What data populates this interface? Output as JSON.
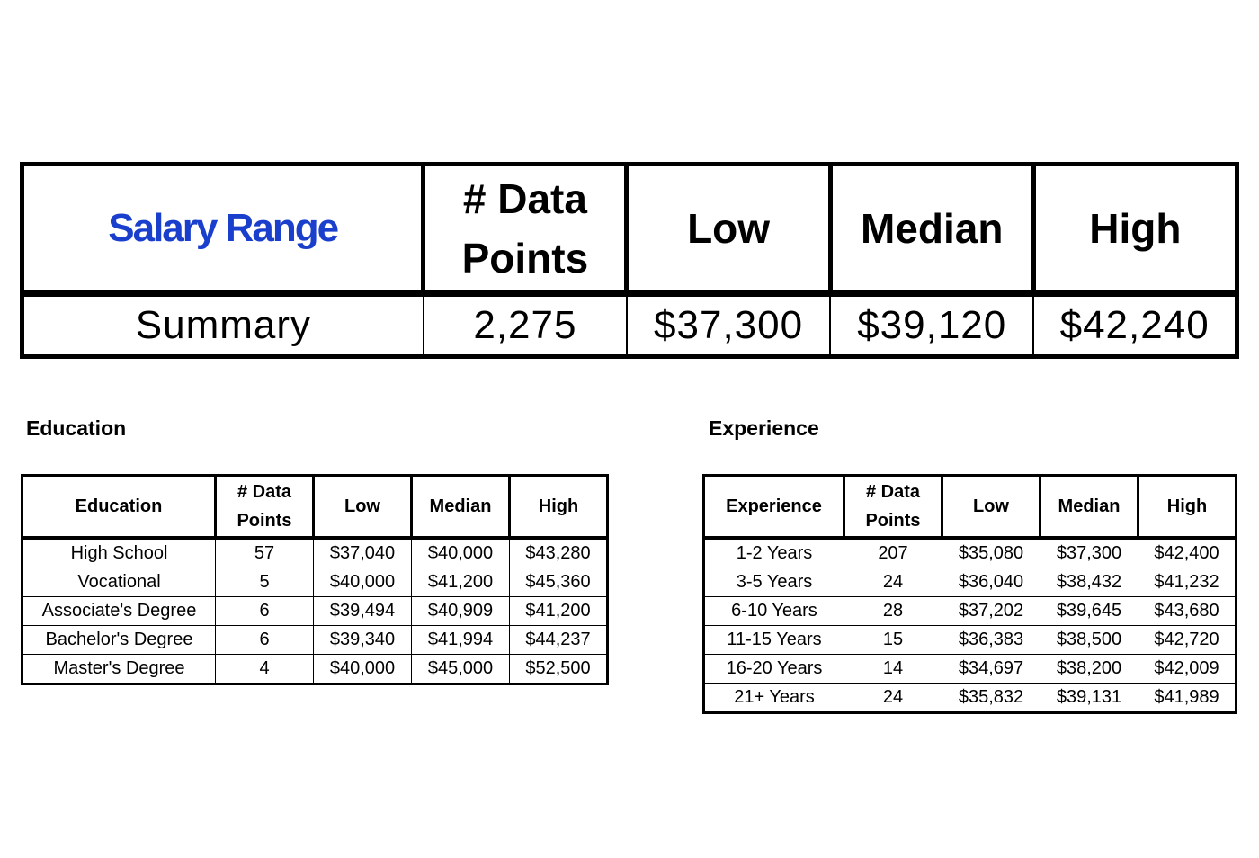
{
  "summary": {
    "headers": [
      "Salary Range",
      "# Data Points",
      "Low",
      "Median",
      "High"
    ],
    "header_color": "#1a3fcc",
    "row": [
      "Summary",
      "2,275",
      "$37,300",
      "$39,120",
      "$42,240"
    ]
  },
  "education": {
    "label": "Education",
    "headers": [
      "Education",
      "# Data Points",
      "Low",
      "Median",
      "High"
    ],
    "rows": [
      [
        "High School",
        "57",
        "$37,040",
        "$40,000",
        "$43,280"
      ],
      [
        "Vocational",
        "5",
        "$40,000",
        "$41,200",
        "$45,360"
      ],
      [
        "Associate's Degree",
        "6",
        "$39,494",
        "$40,909",
        "$41,200"
      ],
      [
        "Bachelor's Degree",
        "6",
        "$39,340",
        "$41,994",
        "$44,237"
      ],
      [
        "Master's Degree",
        "4",
        "$40,000",
        "$45,000",
        "$52,500"
      ]
    ]
  },
  "experience": {
    "label": "Experience",
    "headers": [
      "Experience",
      "# Data Points",
      "Low",
      "Median",
      "High"
    ],
    "rows": [
      [
        "1-2 Years",
        "207",
        "$35,080",
        "$37,300",
        "$42,400"
      ],
      [
        "3-5 Years",
        "24",
        "$36,040",
        "$38,432",
        "$41,232"
      ],
      [
        "6-10 Years",
        "28",
        "$37,202",
        "$39,645",
        "$43,680"
      ],
      [
        "11-15 Years",
        "15",
        "$36,383",
        "$38,500",
        "$42,720"
      ],
      [
        "16-20 Years",
        "14",
        "$34,697",
        "$38,200",
        "$42,009"
      ],
      [
        "21+ Years",
        "24",
        "$35,832",
        "$39,131",
        "$41,989"
      ]
    ]
  }
}
